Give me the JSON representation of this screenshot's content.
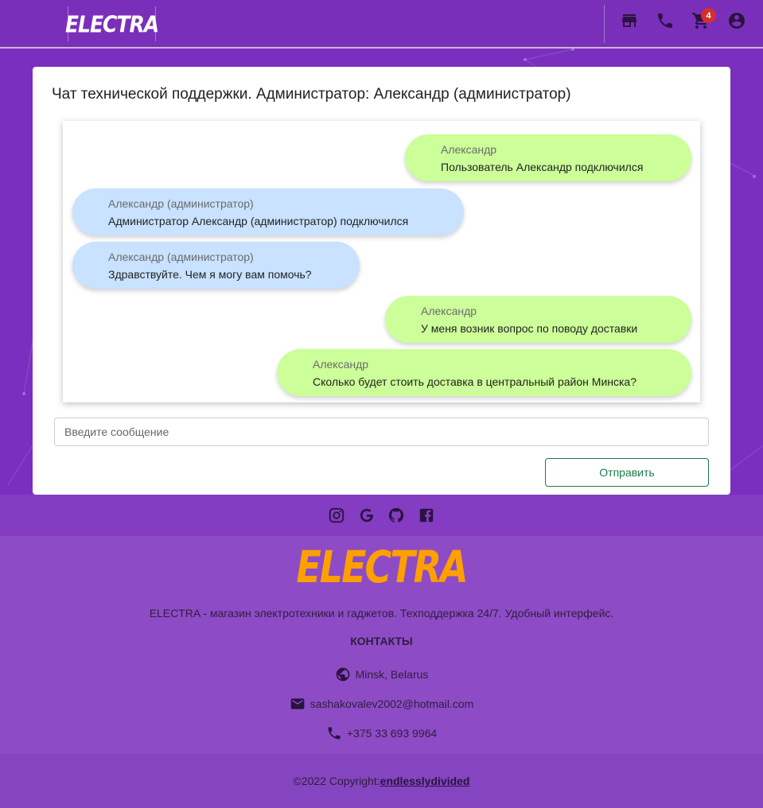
{
  "header": {
    "logo": "ELECTRA",
    "cart_count": "4",
    "icons": [
      "store-icon",
      "phone-icon",
      "cart-icon",
      "account-icon"
    ]
  },
  "chat": {
    "title": "Чат технической поддержки. Администратор: Александр (администратор)",
    "messages": [
      {
        "role": "user",
        "sender": "Александр",
        "text": "Пользователь Александр подключился"
      },
      {
        "role": "admin",
        "sender": "Александр (администратор)",
        "text": "Администратор Александр (администратор) подключился"
      },
      {
        "role": "admin",
        "sender": "Александр (администратор)",
        "text": "Здравствуйте. Чем я могу вам помочь?"
      },
      {
        "role": "user",
        "sender": "Александр",
        "text": "У меня возник вопрос по поводу доставки"
      },
      {
        "role": "user",
        "sender": "Александр",
        "text": "Сколько будет стоить доставка в центральный район Минска?"
      }
    ],
    "input_placeholder": "Введите сообщение",
    "input_value": "",
    "send_label": "Отправить"
  },
  "footer": {
    "social": [
      "instagram-icon",
      "google-icon",
      "github-icon",
      "facebook-icon"
    ],
    "logo": "ELECTRA",
    "description": "ELECTRA - магазин электротехники и гаджетов. Техподдержка 24/7. Удобный интерфейс.",
    "contacts_title": "КОНТАКТЫ",
    "location": "Minsk, Belarus",
    "email": "sashakovalev2002@hotmail.com",
    "phone": "+375 33 693 9964",
    "copyright": "©2022 Copyright:",
    "author": "endlesslydivided"
  },
  "colors": {
    "background": "#7b2fbf",
    "user_bubble": "#ccff99",
    "admin_bubble": "#c8e2ff",
    "send_button": "#1b7c4a",
    "footer_logo": "#ffa000",
    "badge": "#d32f2f"
  }
}
